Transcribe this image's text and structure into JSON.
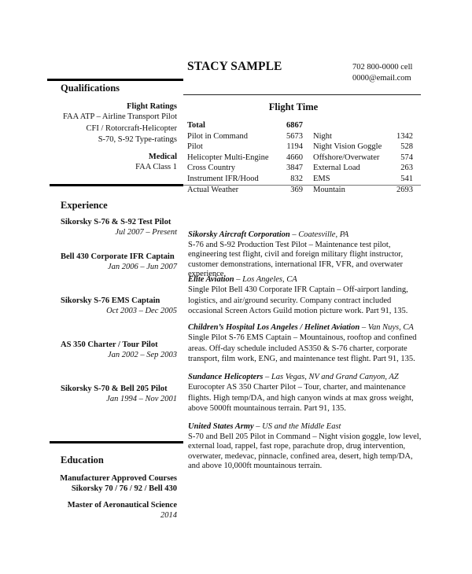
{
  "header": {
    "name": "STACY SAMPLE",
    "phone": "702 800-0000 cell",
    "email": "0000@email.com"
  },
  "qualifications": {
    "title": "Qualifications",
    "groups": [
      {
        "heading": "Flight Ratings",
        "items": [
          "FAA ATP – Airline Transport Pilot",
          "CFI / Rotorcraft-Helicopter",
          "S-70, S-92 Type-ratings"
        ]
      },
      {
        "heading": "Medical",
        "items": [
          "FAA Class 1"
        ]
      }
    ]
  },
  "flight_time": {
    "title": "Flight Time",
    "total_label": "Total",
    "total_value": "6867",
    "rows": [
      {
        "label": "Pilot in Command",
        "value": "5673",
        "label2": "Night",
        "value2": "1342"
      },
      {
        "label": "Pilot",
        "value": "1194",
        "label2": "Night Vision Goggle",
        "value2": "528"
      },
      {
        "label": "Helicopter Multi-Engine",
        "value": "4660",
        "label2": "Offshore/Overwater",
        "value2": "574"
      },
      {
        "label": "Cross Country",
        "value": "3847",
        "label2": "External Load",
        "value2": "263"
      },
      {
        "label": "Instrument IFR/Hood",
        "value": "832",
        "label2": "EMS",
        "value2": "541"
      },
      {
        "label": "Actual Weather",
        "value": "369",
        "label2": "Mountain",
        "value2": "2693"
      }
    ]
  },
  "experience": {
    "title": "Experience",
    "positions": [
      {
        "title": "Sikorsky S-76 & S-92 Test Pilot",
        "dates": "Jul 2007 – Present"
      },
      {
        "title": "Bell 430 Corporate IFR Captain",
        "dates": "Jan 2006 – Jun 2007"
      },
      {
        "title": "Sikorsky S-76 EMS Captain",
        "dates": "Oct 2003 – Dec 2005"
      },
      {
        "title": "AS 350 Charter / Tour Pilot",
        "dates": "Jan 2002 – Sep 2003"
      },
      {
        "title": "Sikorsky S-70 & Bell 205 Pilot",
        "dates": "Jan 1994 – Nov 2001"
      }
    ],
    "details": [
      {
        "org": "Sikorsky Aircraft Corporation",
        "location": " – Coatesville, PA",
        "description": "S-76 and S-92 Production Test Pilot – Maintenance test pilot, engineering test flight, civil and foreign military flight instructor, customer demonstrations, international IFR, VFR, and overwater experience."
      },
      {
        "org": "Elite Aviation",
        "location": " – Los Angeles, CA",
        "description": "Single Pilot Bell 430 Corporate IFR Captain – Off-airport landing, logistics, and air/ground security. Company contract included occasional Screen Actors Guild motion picture work. Part 91, 135."
      },
      {
        "org": "Children’s Hospital Los Angeles / Helinet Aviation",
        "location": " – Van Nuys, CA",
        "description": "Single Pilot S-76 EMS Captain – Mountainous, rooftop and confined areas. Off-day schedule included AS350 & S-76 charter, corporate transport, film work, ENG, and maintenance test flight. Part 91, 135."
      },
      {
        "org": "Sundance Helicopters",
        "location": " – Las Vegas, NV and Grand Canyon, AZ",
        "description": "Eurocopter AS 350 Charter Pilot – Tour, charter, and maintenance flights. High temp/DA, and high canyon winds at max gross weight, above 5000ft mountainous terrain. Part 91, 135."
      },
      {
        "org": "United States Army",
        "location": " – US and the Middle East",
        "description": "S-70 and Bell 205 Pilot in Command – Night vision goggle, low level, external load, rappel, fast rope, parachute drop, drug intervention, overwater, medevac, pinnacle, confined area, desert, high temp/DA, and above 10,000ft mountainous terrain."
      }
    ]
  },
  "education": {
    "title": "Education",
    "items": [
      {
        "line1": "Manufacturer Approved Courses",
        "line2": "Sikorsky 70 / 76 / 92 / Bell 430",
        "line2_italic": false
      },
      {
        "line1": "Master of Aeronautical Science",
        "line2": "2014",
        "line2_italic": true
      }
    ]
  }
}
